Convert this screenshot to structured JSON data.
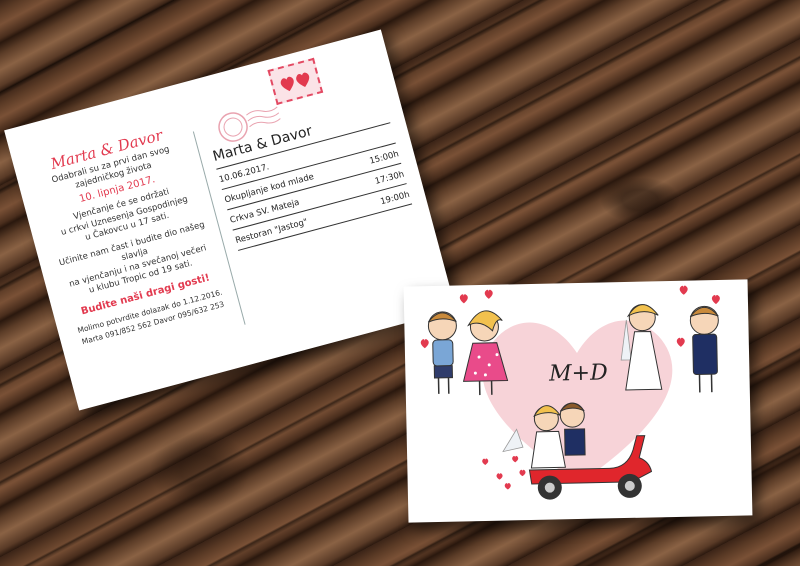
{
  "back_card": {
    "names": "Marta & Davor",
    "line1": "Odabrali su za prvi dan svog",
    "line2": "zajedničkog života",
    "date": "10. lipnja 2017.",
    "line3": "Vjenčanje će se održati",
    "line4": "u crkvi Uznesenja Gospodinjeg",
    "line5": "u Čakovcu u 17 sati.",
    "line6": "Učinite nam čast i budite dio našeg slavlja",
    "line7": "na vjenčanju i na svečanoj večeri",
    "line8": "u klubu Tropic od 19 sati.",
    "welcome": "Budite naši dragi gosti!",
    "rsvp1": "Molimo potvrdite dolazak do 1.12.2016.",
    "rsvp2": "Marta 091/852 562 Davor 095/632 253",
    "schedule_title": "Marta & Davor",
    "schedule": [
      {
        "label": "10.06.2017.",
        "time": ""
      },
      {
        "label": "Okupljanje kod mlade",
        "time": "15:00h"
      },
      {
        "label": "Crkva SV. Mateja",
        "time": "17:30h"
      },
      {
        "label": "Restoran \"Jastog\"",
        "time": "19:00h"
      }
    ]
  },
  "front_card": {
    "monogram": "M+D"
  },
  "colors": {
    "accent_red": "#e23a4f",
    "heart_pink": "#f7d3d8",
    "scooter_red": "#e0262c"
  }
}
